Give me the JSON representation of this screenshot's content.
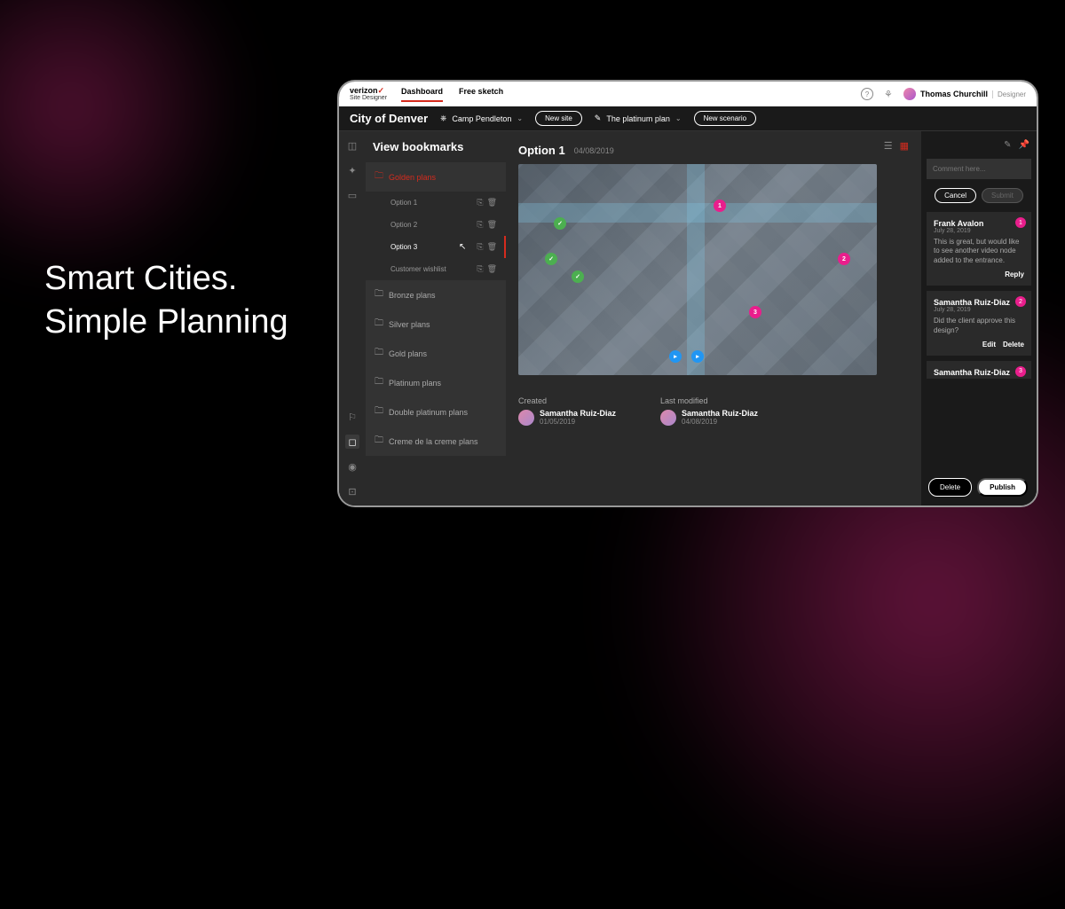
{
  "marketing": {
    "headline_line1": "Smart Cities.",
    "headline_line2": "Simple Planning"
  },
  "brand": {
    "name": "verizon",
    "sub": "Site Designer"
  },
  "tabs": {
    "dashboard": "Dashboard",
    "free_sketch": "Free sketch"
  },
  "user": {
    "name": "Thomas Churchill",
    "role": "Designer"
  },
  "subheader": {
    "city": "City of Denver",
    "location": "Camp Pendleton",
    "new_site": "New site",
    "plan": "The platinum plan",
    "new_scenario": "New scenario"
  },
  "sidebar": {
    "title": "View bookmarks",
    "folders": {
      "golden": "Golden plans",
      "bronze": "Bronze plans",
      "silver": "Silver plans",
      "gold": "Gold plans",
      "platinum": "Platinum plans",
      "double_platinum": "Double platinum plans",
      "creme": "Creme de la creme plans"
    },
    "options": {
      "opt1": "Option 1",
      "opt2": "Option 2",
      "opt3": "Option 3",
      "wishlist": "Customer wishlist"
    }
  },
  "main": {
    "title": "Option 1",
    "date": "04/08/2019",
    "created_label": "Created",
    "modified_label": "Last modified",
    "created_by": "Samantha Ruiz-Diaz",
    "created_date": "01/05/2019",
    "modified_by": "Samantha Ruiz-Diaz",
    "modified_date": "04/08/2019"
  },
  "comments": {
    "placeholder": "Comment here...",
    "cancel": "Cancel",
    "submit": "Submit",
    "reply": "Reply",
    "edit": "Edit",
    "delete": "Delete",
    "items": [
      {
        "author": "Frank Avalon",
        "date": "July 28, 2019",
        "text": "This is great, but would like to see another video node added to the entrance.",
        "badge": "1"
      },
      {
        "author": "Samantha Ruiz-Diaz",
        "date": "July 28, 2019",
        "text": "Did the client approve this design?",
        "badge": "2"
      },
      {
        "author": "Samantha Ruiz-Diaz",
        "date": "",
        "text": "",
        "badge": "3"
      }
    ]
  },
  "footer": {
    "delete": "Delete",
    "publish": "Publish"
  }
}
